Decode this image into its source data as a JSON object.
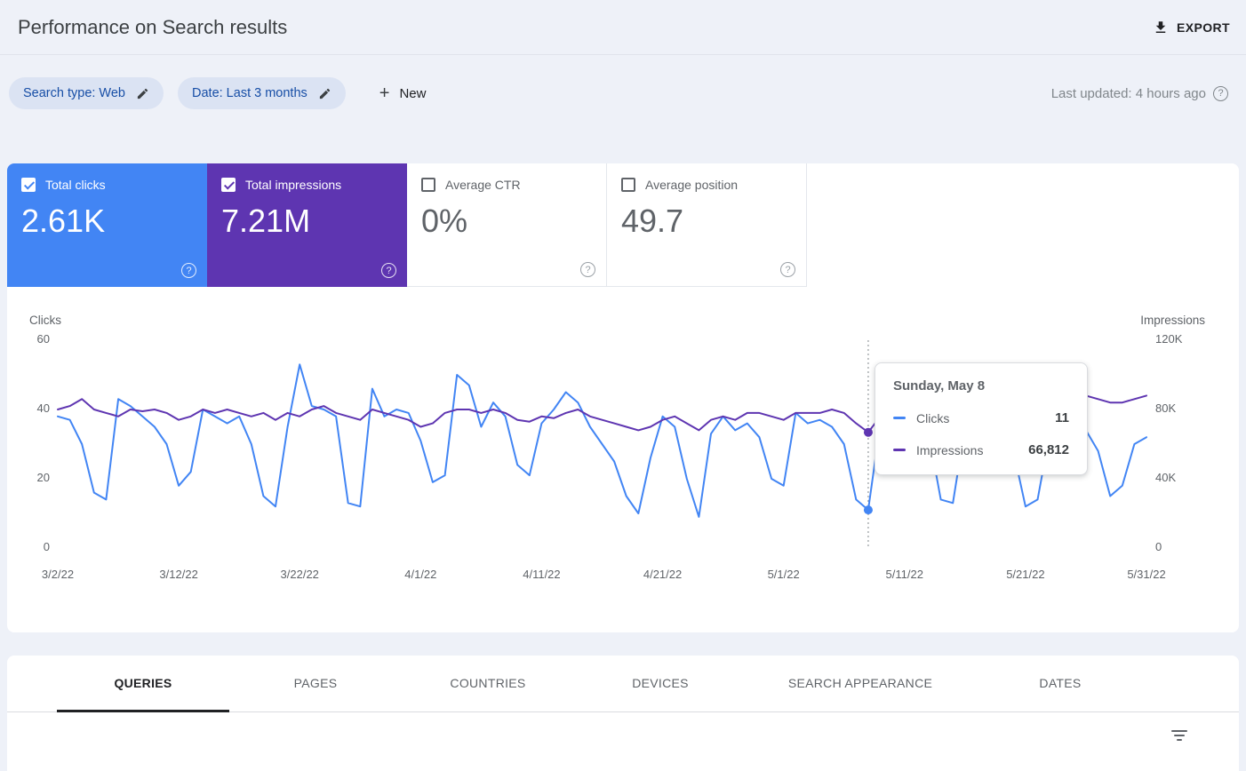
{
  "header": {
    "title": "Performance on Search results",
    "export_label": "EXPORT"
  },
  "filters": {
    "chips": [
      {
        "label": "Search type: Web"
      },
      {
        "label": "Date: Last 3 months"
      }
    ],
    "new_label": "New",
    "last_updated": "Last updated: 4 hours ago"
  },
  "icons": {
    "plus": "+",
    "help": "?"
  },
  "metrics": [
    {
      "label": "Total clicks",
      "value": "2.61K",
      "checked": true,
      "color": "#4285f4"
    },
    {
      "label": "Total impressions",
      "value": "7.21M",
      "checked": true,
      "color": "#5e35b1"
    },
    {
      "label": "Average CTR",
      "value": "0%",
      "checked": false,
      "color": null
    },
    {
      "label": "Average position",
      "value": "49.7",
      "checked": false,
      "color": null
    }
  ],
  "tooltip": {
    "title": "Sunday, May 8",
    "rows": [
      {
        "label": "Clicks",
        "value": "11",
        "color": "#4285f4"
      },
      {
        "label": "Impressions",
        "value": "66,812",
        "color": "#5e35b1"
      }
    ]
  },
  "chart_data": {
    "type": "line",
    "title": "Performance over time",
    "x_axis": {
      "tick_indices": [
        0,
        10,
        20,
        30,
        40,
        50,
        60,
        70,
        80,
        90
      ],
      "tick_labels": [
        "3/2/22",
        "3/12/22",
        "3/22/22",
        "4/1/22",
        "4/11/22",
        "4/21/22",
        "5/1/22",
        "5/11/22",
        "5/21/22",
        "5/31/22"
      ]
    },
    "y_left": {
      "label": "Clicks",
      "ticks": [
        60,
        40,
        20,
        0
      ],
      "max": 60
    },
    "y_right": {
      "label": "Impressions",
      "ticks": [
        "120K",
        "80K",
        "40K",
        "0"
      ],
      "max": 120000
    },
    "series": [
      {
        "name": "Clicks",
        "color": "#4285f4",
        "axis": "left",
        "values": [
          38,
          37,
          30,
          16,
          14,
          43,
          41,
          38,
          35,
          30,
          18,
          22,
          40,
          38,
          36,
          38,
          30,
          15,
          12,
          35,
          53,
          41,
          40,
          38,
          13,
          12,
          46,
          38,
          40,
          39,
          31,
          19,
          21,
          50,
          47,
          35,
          42,
          38,
          24,
          21,
          36,
          40,
          45,
          42,
          35,
          30,
          25,
          15,
          10,
          26,
          38,
          35,
          20,
          9,
          33,
          38,
          34,
          36,
          32,
          20,
          18,
          39,
          36,
          37,
          35,
          30,
          14,
          11,
          36,
          35,
          38,
          44,
          33,
          14,
          13,
          35,
          37,
          34,
          39,
          28,
          12,
          14,
          33,
          36,
          35,
          34,
          28,
          15,
          18,
          30,
          32
        ]
      },
      {
        "name": "Impressions",
        "color": "#5e35b1",
        "axis": "right",
        "values": [
          80000,
          82000,
          86000,
          80000,
          78000,
          76000,
          80000,
          79000,
          80000,
          78000,
          74000,
          76000,
          80000,
          78000,
          80000,
          78000,
          76000,
          78000,
          74000,
          78000,
          76000,
          80000,
          82000,
          78000,
          76000,
          74000,
          80000,
          78000,
          76000,
          74000,
          70000,
          72000,
          78000,
          80000,
          80000,
          78000,
          80000,
          78000,
          74000,
          73000,
          76000,
          75000,
          78000,
          80000,
          76000,
          74000,
          72000,
          70000,
          68000,
          70000,
          74000,
          76000,
          72000,
          68000,
          74000,
          76000,
          74000,
          78000,
          78000,
          76000,
          74000,
          78000,
          78000,
          78000,
          80000,
          78000,
          72000,
          66812,
          76000,
          78000,
          80000,
          82000,
          80000,
          76000,
          74000,
          80000,
          84000,
          82000,
          84000,
          82000,
          78000,
          76000,
          82000,
          86000,
          90000,
          88000,
          86000,
          84000,
          84000,
          86000,
          88000
        ]
      }
    ],
    "highlight": {
      "index": 67,
      "date": "Sunday, May 8",
      "clicks": 11,
      "impressions": 66812
    }
  },
  "tabs": {
    "active_index": 0,
    "items": [
      "QUERIES",
      "PAGES",
      "COUNTRIES",
      "DEVICES",
      "SEARCH APPEARANCE",
      "DATES"
    ]
  }
}
